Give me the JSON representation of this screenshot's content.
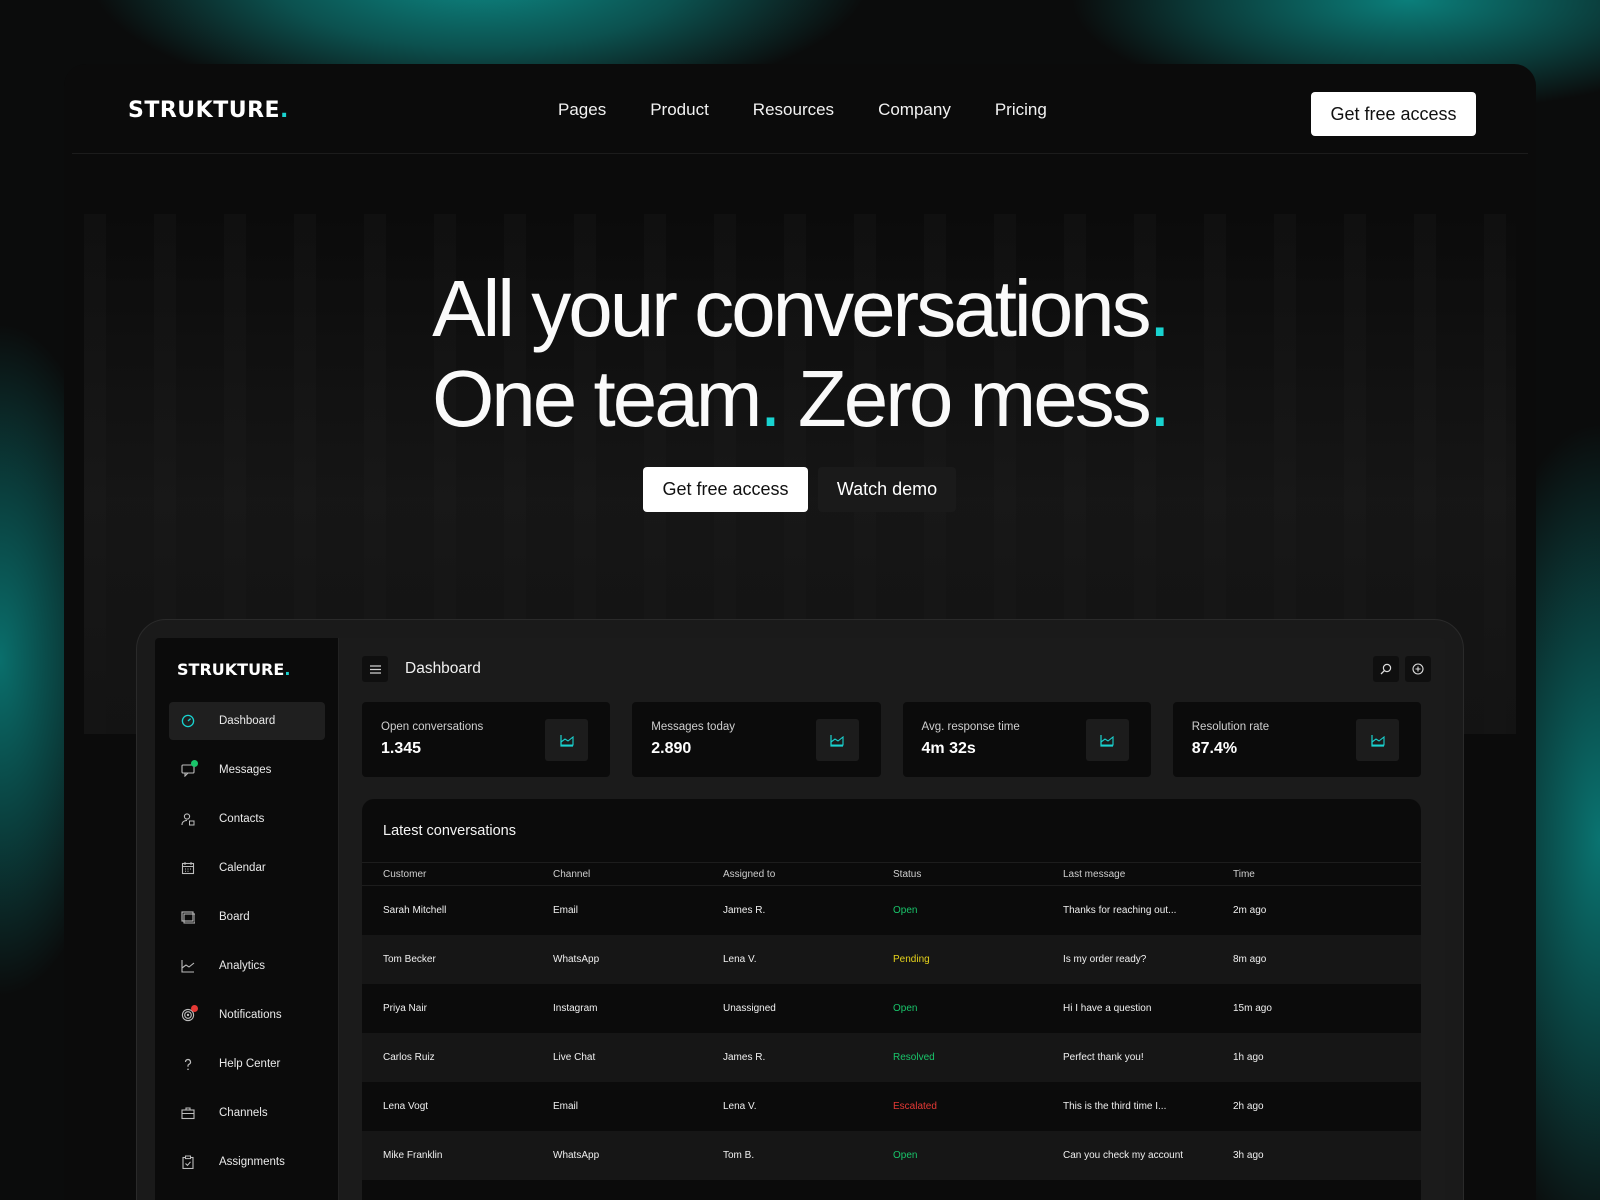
{
  "brand": {
    "name": "STRUKTURE",
    "dot": ".",
    "accent": "#19d3d0"
  },
  "nav": {
    "links": [
      "Pages",
      "Product",
      "Resources",
      "Company",
      "Pricing"
    ],
    "cta": "Get free access"
  },
  "hero": {
    "line1": "All your conversations",
    "line2a": "One team",
    "line2b": " Zero mess",
    "dot": ".",
    "primary_cta": "Get free access",
    "secondary_cta": "Watch demo"
  },
  "dashboard": {
    "title": "Dashboard",
    "sidebar": [
      {
        "label": "Dashboard",
        "icon": "gauge-icon",
        "active": true
      },
      {
        "label": "Messages",
        "icon": "chat-icon",
        "badge": "#19c46a"
      },
      {
        "label": "Contacts",
        "icon": "user-icon"
      },
      {
        "label": "Calendar",
        "icon": "calendar-icon"
      },
      {
        "label": "Board",
        "icon": "board-icon"
      },
      {
        "label": "Analytics",
        "icon": "chart-icon"
      },
      {
        "label": "Notifications",
        "icon": "target-icon",
        "badge": "#e53935"
      },
      {
        "label": "Help Center",
        "icon": "help-icon"
      },
      {
        "label": "Channels",
        "icon": "briefcase-icon"
      },
      {
        "label": "Assignments",
        "icon": "clipboard-icon"
      }
    ],
    "stats": [
      {
        "label": "Open conversations",
        "value": "1.345"
      },
      {
        "label": "Messages today",
        "value": "2.890"
      },
      {
        "label": "Avg. response time",
        "value": "4m 32s"
      },
      {
        "label": "Resolution rate",
        "value": "87.4%"
      }
    ],
    "table": {
      "title": "Latest conversations",
      "columns": [
        "Customer",
        "Channel",
        "Assigned to",
        "Status",
        "Last message",
        "Time"
      ],
      "rows": [
        [
          "Sarah Mitchell",
          "Email",
          "James R.",
          "Open",
          "Thanks for reaching out...",
          "2m ago"
        ],
        [
          "Tom Becker",
          "WhatsApp",
          "Lena V.",
          "Pending",
          "Is my order ready?",
          "8m ago"
        ],
        [
          "Priya Nair",
          "Instagram",
          "Unassigned",
          "Open",
          "Hi I have a question",
          "15m ago"
        ],
        [
          "Carlos Ruiz",
          "Live Chat",
          "James R.",
          "Resolved",
          "Perfect thank you!",
          "1h ago"
        ],
        [
          "Lena Vogt",
          "Email",
          "Lena V.",
          "Escalated",
          "This is the third time I...",
          "2h ago"
        ],
        [
          "Mike Franklin",
          "WhatsApp",
          "Tom B.",
          "Open",
          "Can you check my account",
          "3h ago"
        ]
      ]
    },
    "status_colors": {
      "Open": "#19c46a",
      "Pending": "#e5d21b",
      "Resolved": "#19c46a",
      "Escalated": "#e53935"
    }
  }
}
